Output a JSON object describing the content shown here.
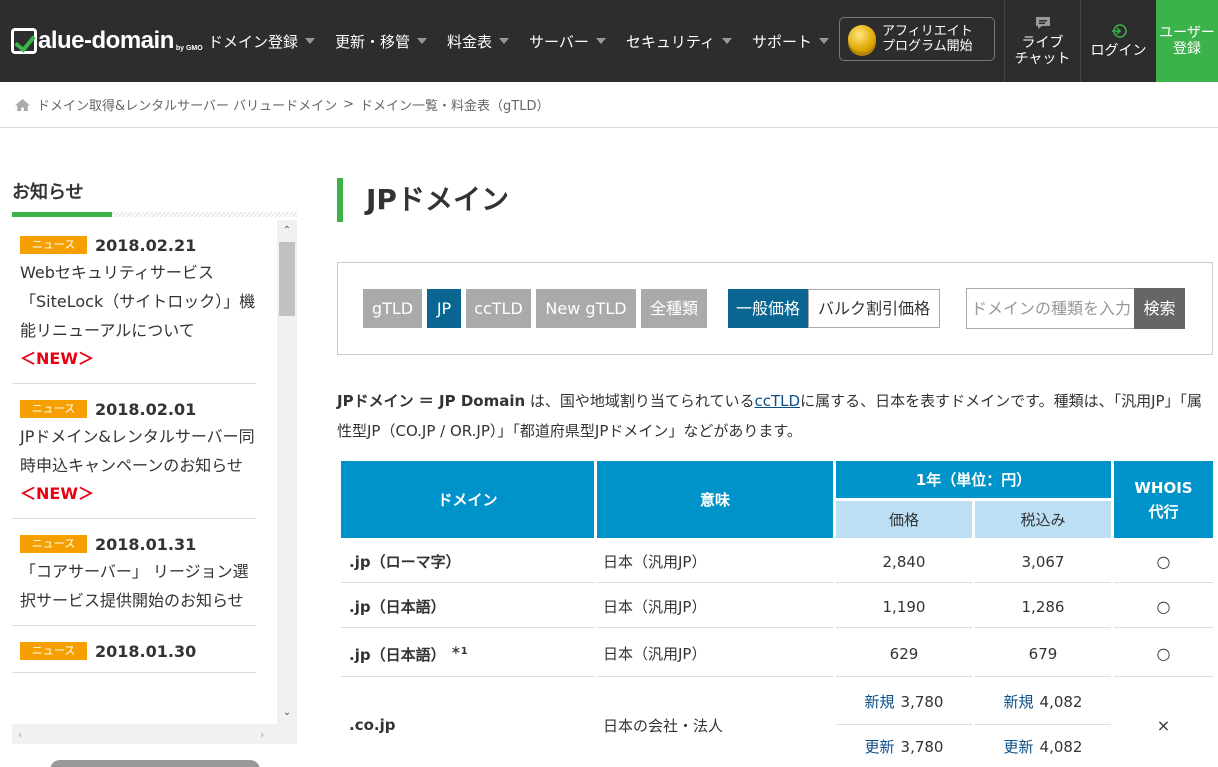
{
  "header": {
    "logo_text": "alue-domain",
    "logo_suffix": "by GMO",
    "nav": [
      "ドメイン登録",
      "更新・移管",
      "料金表",
      "サーバー",
      "セキュリティ",
      "サポート"
    ],
    "affiliate_line1": "アフィリエイト",
    "affiliate_line2": "プログラム開始",
    "chat_line1": "ライブ",
    "chat_line2": "チャット",
    "login": "ログイン",
    "register_line1": "ユーザー",
    "register_line2": "登録"
  },
  "breadcrumb": {
    "home": "ドメイン取得&レンタルサーバー バリュードメイン",
    "sep": ">",
    "current": "ドメイン一覧・料金表（gTLD）"
  },
  "sidebar": {
    "title": "お知らせ",
    "badge": "ニュース",
    "new_label": "＜NEW＞",
    "items": [
      {
        "date": "2018.02.21",
        "text": "Webセキュリティサービス「SiteLock（サイトロック）」機能リニューアルについて"
      },
      {
        "date": "2018.02.01",
        "text": "JPドメイン&レンタルサーバー同時申込キャンペーンのお知らせ"
      },
      {
        "date": "2018.01.31",
        "text": "「コアサーバー」 リージョン選択サービス提供開始のお知らせ"
      },
      {
        "date": "2018.01.30",
        "text": ""
      }
    ]
  },
  "main": {
    "title": "JPドメイン",
    "tabs": [
      "gTLD",
      "JP",
      "ccTLD",
      "New gTLD",
      "全種類"
    ],
    "price_general": "一般価格",
    "price_bulk": "バルク割引価格",
    "search_placeholder": "ドメインの種類を入力",
    "search_button": "検索",
    "desc_bold": "JPドメイン ＝ JP Domain",
    "desc_1": " は、国や地域割り当てられている",
    "desc_link": "ccTLD",
    "desc_2": "に属する、日本を表すドメインです。種類は、「汎用JP」「属性型JP（CO.JP / OR.JP）」「都道府県型JPドメイン」などがあります。"
  },
  "table": {
    "headers": {
      "domain": "ドメイン",
      "meaning": "意味",
      "year": "1年（単位：円）",
      "price": "価格",
      "tax": "税込み",
      "whois": "WHOIS\n代行"
    },
    "new_label": "新規",
    "renew_label": "更新",
    "rows": [
      {
        "domain": ".jp（ローマ字）",
        "note": "",
        "meaning": "日本（汎用JP）",
        "price": "2,840",
        "tax": "3,067",
        "whois": "○"
      },
      {
        "domain": ".jp（日本語）",
        "note": "",
        "meaning": "日本（汎用JP）",
        "price": "1,190",
        "tax": "1,286",
        "whois": "○"
      },
      {
        "domain": ".jp（日本語）",
        "note": "＊1",
        "meaning": "日本（汎用JP）",
        "price": "629",
        "tax": "679",
        "whois": "○"
      }
    ],
    "cojp": {
      "domain": ".co.jp",
      "meaning": "日本の会社・法人",
      "new_price": "3,780",
      "renew_price": "3,780",
      "new_tax": "4,082",
      "renew_tax": "4,082",
      "whois": "×"
    }
  },
  "colors": {
    "header_bg": "#2d2d2d",
    "accent_green": "#3cb34a",
    "active_blue": "#0a6690",
    "table_head": "#0093c9",
    "new_red": "#e60012",
    "badge": "#f5a000"
  }
}
